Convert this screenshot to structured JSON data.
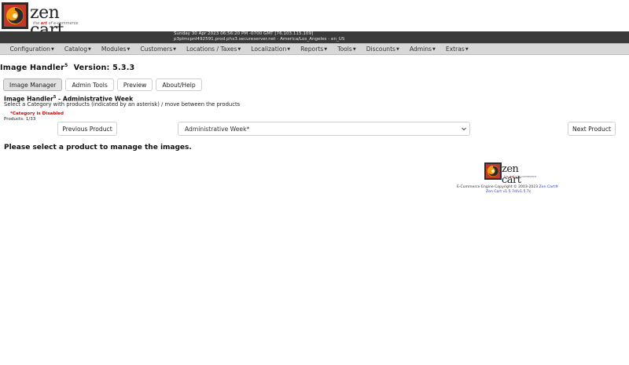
{
  "brand": {
    "name": "zen cart",
    "tagline_pre": "the ",
    "tagline_art": "art",
    "tagline_post": " of e-commerce"
  },
  "infobar": {
    "line1": "Sunday 30 Apr 2023 06:56:20 PM -0700 GMT [76.103.115.109]",
    "line2": "p3plmcpnl492591.prod.phx3.secureserver.net - America/Los_Angeles - en_US"
  },
  "menu": [
    {
      "label": "Configuration"
    },
    {
      "label": "Catalog"
    },
    {
      "label": "Modules"
    },
    {
      "label": "Customers"
    },
    {
      "label": "Locations / Taxes"
    },
    {
      "label": "Localization"
    },
    {
      "label": "Reports"
    },
    {
      "label": "Tools"
    },
    {
      "label": "Discounts"
    },
    {
      "label": "Admins"
    },
    {
      "label": "Extras"
    }
  ],
  "page": {
    "title_main": "Image Handler",
    "title_sup": "5",
    "title_version": "Version: 5.3.3"
  },
  "tabs": [
    {
      "label": "Image Manager",
      "active": true
    },
    {
      "label": "Admin Tools"
    },
    {
      "label": "Preview"
    },
    {
      "label": "About/Help"
    }
  ],
  "section": {
    "title_main": "Image Handler",
    "title_sup": "5",
    "title_rest": " - Administrative Week",
    "instructions": "Select a Category with products (indicated by an asterisk) / move between the products",
    "disabled_note": "*Category is Disabled",
    "products_count": "Products: 1/33"
  },
  "nav": {
    "prev_label": "Previous Product",
    "next_label": "Next Product",
    "category_selected": "Administrative Week*"
  },
  "message": "Please select a product to manage the images.",
  "footer": {
    "copyright_pre": "E-Commerce Engine Copyright © 2003-2023 ",
    "copyright_link": "Zen Cart®",
    "version": "Zen Cart v1.5.7d/v1.5.7c"
  },
  "colors": {
    "infobar_bg": "#3a3a3a",
    "menubar_bg": "#d8d8d8",
    "disabled_red": "#dd0000",
    "link_blue": "#2a3ca8"
  }
}
